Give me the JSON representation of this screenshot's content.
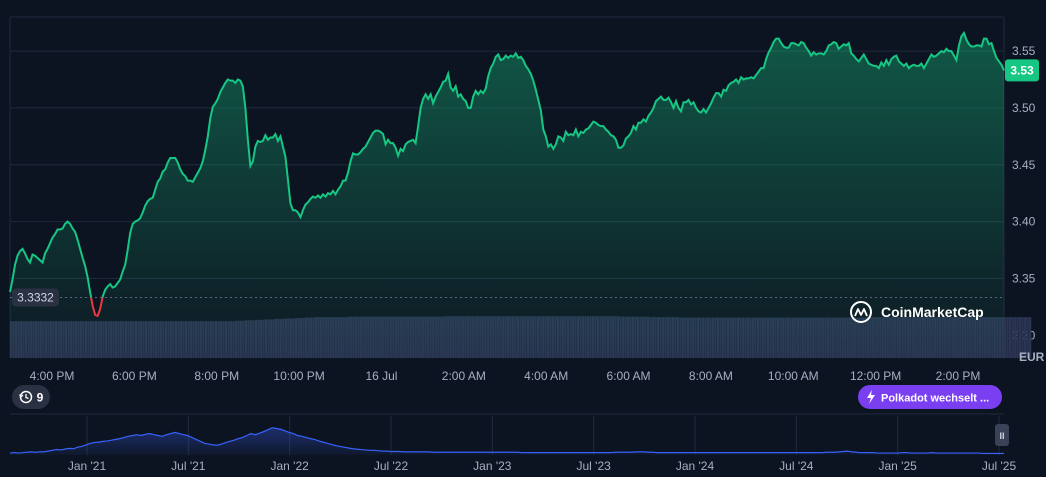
{
  "chart_data": {
    "type": "area",
    "currency_label": "EUR",
    "current_price_label": "3.53",
    "reference_price_label": "3.3332",
    "reference_price": 3.3332,
    "ylim": [
      3.28,
      3.58
    ],
    "y_ticks": [
      3.3,
      3.35,
      3.4,
      3.45,
      3.5,
      3.55
    ],
    "x_ticks": [
      "4:00 PM",
      "6:00 PM",
      "8:00 PM",
      "10:00 PM",
      "16 Jul",
      "2:00 AM",
      "4:00 AM",
      "6:00 AM",
      "8:00 AM",
      "10:00 AM",
      "12:00 PM",
      "2:00 PM"
    ],
    "x": [
      0,
      1,
      2,
      3,
      4,
      5,
      6,
      7,
      8,
      9,
      10,
      11,
      12,
      13,
      14,
      15,
      16,
      17,
      18,
      19,
      20,
      21,
      22,
      23,
      24,
      25,
      26,
      27,
      28,
      29,
      30,
      31,
      32,
      33,
      34,
      35,
      36,
      37,
      38,
      39,
      40,
      41,
      42,
      43,
      44,
      45,
      46,
      47,
      48,
      49,
      50,
      51,
      52,
      53,
      54,
      55,
      56,
      57,
      58,
      59,
      60,
      61,
      62,
      63,
      64,
      65,
      66,
      67,
      68,
      69,
      70,
      71,
      72,
      73,
      74,
      75,
      76,
      77,
      78,
      79,
      80,
      81,
      82,
      83,
      84,
      85,
      86,
      87,
      88,
      89,
      90,
      91,
      92,
      93,
      94,
      95,
      96,
      97,
      98,
      99,
      100,
      101,
      102,
      103,
      104,
      105,
      106,
      107,
      108,
      109,
      110,
      111,
      112,
      113,
      114,
      115,
      116,
      117,
      118,
      119,
      120,
      121,
      122,
      123,
      124,
      125,
      126,
      127,
      128,
      129,
      130,
      131,
      132,
      133,
      134,
      135,
      136,
      137,
      138,
      139,
      140,
      141,
      142,
      143,
      144,
      145,
      146,
      147,
      148,
      149,
      150,
      151,
      152,
      153,
      154,
      155,
      156,
      157,
      158,
      159,
      160,
      161,
      162,
      163,
      164,
      165,
      166,
      167,
      168,
      169,
      170,
      171,
      172,
      173,
      174,
      175,
      176,
      177,
      178,
      179,
      180,
      181,
      182,
      183,
      184,
      185,
      186,
      187,
      188,
      189,
      190,
      191,
      192,
      193,
      194,
      195,
      196,
      197,
      198,
      199,
      200,
      201,
      202,
      203,
      204,
      205,
      206,
      207,
      208,
      209,
      210,
      211,
      212,
      213,
      214,
      215,
      216,
      217,
      218,
      219,
      220,
      221,
      222,
      223,
      224,
      225,
      226,
      227,
      228,
      229,
      230,
      231,
      232,
      233,
      234,
      235,
      236,
      237,
      238,
      239,
      240,
      241,
      242,
      243,
      244,
      245,
      246,
      247,
      248,
      249,
      250,
      251,
      252,
      253,
      254,
      255,
      256,
      257,
      258,
      259,
      260,
      261,
      262,
      263,
      264,
      265,
      266,
      267,
      268,
      269,
      270,
      271,
      272,
      273,
      274,
      275,
      276,
      277,
      278,
      279,
      280,
      281,
      282,
      283,
      284,
      285,
      286,
      287,
      288,
      289,
      290,
      291,
      292,
      293,
      294,
      295,
      296,
      297,
      298,
      299,
      300,
      301,
      302,
      303,
      304,
      305,
      306,
      307,
      308,
      309,
      310,
      311,
      312,
      313,
      314,
      315,
      316,
      317,
      318,
      319,
      320,
      321,
      322,
      323,
      324,
      325,
      326,
      327,
      328,
      329,
      330,
      331,
      332,
      333,
      334,
      335,
      336,
      337,
      338,
      339,
      340,
      341,
      342,
      343,
      344,
      345,
      346,
      347,
      348,
      349,
      350,
      351,
      352,
      353,
      354,
      355,
      356,
      357,
      358,
      359,
      360,
      361,
      362,
      363,
      364,
      365,
      366,
      367,
      368,
      369,
      370,
      371,
      372,
      373,
      374,
      375,
      376,
      377,
      378,
      379,
      380,
      381,
      382,
      383,
      384,
      385,
      386,
      387,
      388,
      389,
      390,
      391,
      392,
      393,
      394,
      395,
      396,
      397,
      398,
      399
    ],
    "values": [
      3.338,
      3.349,
      3.362,
      3.37,
      3.374,
      3.376,
      3.372,
      3.367,
      3.364,
      3.371,
      3.37,
      3.368,
      3.366,
      3.364,
      3.372,
      3.376,
      3.381,
      3.386,
      3.389,
      3.393,
      3.393,
      3.394,
      3.398,
      3.4,
      3.398,
      3.394,
      3.391,
      3.384,
      3.376,
      3.368,
      3.361,
      3.351,
      3.338,
      3.326,
      3.318,
      3.317,
      3.323,
      3.334,
      3.34,
      3.343,
      3.345,
      3.342,
      3.343,
      3.346,
      3.349,
      3.356,
      3.362,
      3.375,
      3.39,
      3.398,
      3.4,
      3.401,
      3.403,
      3.408,
      3.414,
      3.418,
      3.42,
      3.421,
      3.428,
      3.435,
      3.438,
      3.444,
      3.446,
      3.452,
      3.456,
      3.456,
      3.456,
      3.452,
      3.446,
      3.442,
      3.44,
      3.436,
      3.436,
      3.435,
      3.439,
      3.443,
      3.447,
      3.453,
      3.463,
      3.475,
      3.491,
      3.501,
      3.504,
      3.508,
      3.514,
      3.518,
      3.522,
      3.525,
      3.524,
      3.524,
      3.522,
      3.525,
      3.524,
      3.519,
      3.5,
      3.472,
      3.449,
      3.453,
      3.466,
      3.471,
      3.47,
      3.471,
      3.476,
      3.472,
      3.474,
      3.474,
      3.477,
      3.471,
      3.475,
      3.466,
      3.457,
      3.437,
      3.416,
      3.41,
      3.41,
      3.408,
      3.404,
      3.41,
      3.415,
      3.417,
      3.42,
      3.422,
      3.421,
      3.423,
      3.421,
      3.424,
      3.422,
      3.425,
      3.424,
      3.427,
      3.424,
      3.428,
      3.431,
      3.436,
      3.436,
      3.443,
      3.453,
      3.46,
      3.459,
      3.459,
      3.461,
      3.464,
      3.466,
      3.47,
      3.474,
      3.478,
      3.48,
      3.48,
      3.479,
      3.477,
      3.468,
      3.472,
      3.469,
      3.469,
      3.465,
      3.458,
      3.464,
      3.462,
      3.468,
      3.47,
      3.471,
      3.472,
      3.469,
      3.484,
      3.5,
      3.508,
      3.512,
      3.508,
      3.512,
      3.504,
      3.51,
      3.514,
      3.518,
      3.523,
      3.524,
      3.53,
      3.518,
      3.515,
      3.519,
      3.51,
      3.512,
      3.508,
      3.506,
      3.5,
      3.5,
      3.51,
      3.515,
      3.512,
      3.515,
      3.513,
      3.517,
      3.528,
      3.535,
      3.539,
      3.545,
      3.547,
      3.542,
      3.543,
      3.546,
      3.544,
      3.546,
      3.545,
      3.548,
      3.544,
      3.545,
      3.542,
      3.537,
      3.534,
      3.53,
      3.524,
      3.516,
      3.507,
      3.498,
      3.481,
      3.475,
      3.466,
      3.468,
      3.464,
      3.468,
      3.475,
      3.474,
      3.471,
      3.479,
      3.476,
      3.477,
      3.476,
      3.481,
      3.475,
      3.479,
      3.478,
      3.481,
      3.482,
      3.485,
      3.488,
      3.487,
      3.485,
      3.484,
      3.484,
      3.481,
      3.479,
      3.476,
      3.475,
      3.472,
      3.465,
      3.465,
      3.467,
      3.473,
      3.475,
      3.478,
      3.484,
      3.481,
      3.487,
      3.487,
      3.49,
      3.488,
      3.493,
      3.496,
      3.5,
      3.506,
      3.508,
      3.51,
      3.507,
      3.507,
      3.509,
      3.505,
      3.5,
      3.506,
      3.5,
      3.497,
      3.505,
      3.505,
      3.507,
      3.503,
      3.505,
      3.5,
      3.497,
      3.496,
      3.499,
      3.496,
      3.5,
      3.504,
      3.509,
      3.513,
      3.513,
      3.51,
      3.516,
      3.515,
      3.52,
      3.522,
      3.523,
      3.525,
      3.522,
      3.527,
      3.525,
      3.526,
      3.526,
      3.527,
      3.526,
      3.529,
      3.532,
      3.535,
      3.535,
      3.543,
      3.549,
      3.553,
      3.558,
      3.561,
      3.561,
      3.557,
      3.554,
      3.553,
      3.553,
      3.557,
      3.557,
      3.556,
      3.555,
      3.558,
      3.557,
      3.553,
      3.55,
      3.546,
      3.549,
      3.547,
      3.548,
      3.548,
      3.547,
      3.55,
      3.555,
      3.556,
      3.558,
      3.557,
      3.552,
      3.554,
      3.556,
      3.555,
      3.557,
      3.548,
      3.546,
      3.543,
      3.541,
      3.544,
      3.547,
      3.543,
      3.539,
      3.538,
      3.537,
      3.537,
      3.535,
      3.54,
      3.537,
      3.542,
      3.538,
      3.543,
      3.545,
      3.546,
      3.541,
      3.539,
      3.537,
      3.539,
      3.535,
      3.537,
      3.538,
      3.537,
      3.537,
      3.539,
      3.535,
      3.539,
      3.543,
      3.547,
      3.545,
      3.546,
      3.548,
      3.55,
      3.549,
      3.552,
      3.55,
      3.55,
      3.546,
      3.542,
      3.555,
      3.563,
      3.566,
      3.56,
      3.556,
      3.554,
      3.554,
      3.555,
      3.555,
      3.554,
      3.561,
      3.561,
      3.556,
      3.557,
      3.55,
      3.544,
      3.541,
      3.538,
      3.533
    ],
    "volume": [
      0.8,
      0.8,
      0.8,
      0.8,
      0.8,
      0.8,
      0.8,
      0.8,
      0.8,
      0.8,
      0.8,
      0.8,
      0.8,
      0.8,
      0.8,
      0.8,
      0.8,
      0.8,
      0.8,
      0.8,
      0.8,
      0.8,
      0.8,
      0.8,
      0.8,
      0.8,
      0.8,
      0.8,
      0.8,
      0.8,
      0.8,
      0.8,
      0.8,
      0.8,
      0.8,
      0.8,
      0.8,
      0.8,
      0.8,
      0.8,
      0.8,
      0.8,
      0.8,
      0.8,
      0.8,
      0.8,
      0.8,
      0.8,
      0.8,
      0.8,
      0.8,
      0.8,
      0.8,
      0.8,
      0.8,
      0.8,
      0.8,
      0.8,
      0.8,
      0.8,
      0.8,
      0.8,
      0.8,
      0.8,
      0.8,
      0.8,
      0.8,
      0.8,
      0.8,
      0.8,
      0.8,
      0.8,
      0.8,
      0.8,
      0.8,
      0.8,
      0.8,
      0.8,
      0.8,
      0.8,
      0.8,
      0.8,
      0.8,
      0.8,
      0.8,
      0.8,
      0.8,
      0.8,
      0.8,
      0.8,
      0.81,
      0.81,
      0.81,
      0.81,
      0.82,
      0.82,
      0.82,
      0.82,
      0.83,
      0.83,
      0.83,
      0.83,
      0.84,
      0.84,
      0.84,
      0.84,
      0.85,
      0.85,
      0.85,
      0.85,
      0.86,
      0.86,
      0.86,
      0.86,
      0.87,
      0.87,
      0.87,
      0.87,
      0.88,
      0.88,
      0.88,
      0.88,
      0.89,
      0.89,
      0.89,
      0.89,
      0.89,
      0.89,
      0.89,
      0.89,
      0.89,
      0.89,
      0.89,
      0.89,
      0.89,
      0.9,
      0.9,
      0.9,
      0.9,
      0.9,
      0.9,
      0.9,
      0.9,
      0.9,
      0.9,
      0.9,
      0.9,
      0.9,
      0.9,
      0.9,
      0.9,
      0.9,
      0.9,
      0.9,
      0.9,
      0.9,
      0.9,
      0.9,
      0.9,
      0.9,
      0.9,
      0.9,
      0.9,
      0.9,
      0.9,
      0.9,
      0.9,
      0.9,
      0.9,
      0.9,
      0.9,
      0.9,
      0.9,
      0.9,
      0.91,
      0.91,
      0.91,
      0.91,
      0.91,
      0.91,
      0.91,
      0.91,
      0.91,
      0.91,
      0.91,
      0.91,
      0.91,
      0.91,
      0.91,
      0.91,
      0.91,
      0.91,
      0.91,
      0.91,
      0.91,
      0.91,
      0.91,
      0.91,
      0.91,
      0.91,
      0.91,
      0.91,
      0.91,
      0.91,
      0.91,
      0.91,
      0.91,
      0.91,
      0.91,
      0.91,
      0.91,
      0.91,
      0.91,
      0.91,
      0.91,
      0.91,
      0.91,
      0.91,
      0.91,
      0.91,
      0.91,
      0.91,
      0.91,
      0.91,
      0.91,
      0.91,
      0.91,
      0.91,
      0.91,
      0.91,
      0.91,
      0.91,
      0.91,
      0.91,
      0.91,
      0.91,
      0.91,
      0.91,
      0.91,
      0.91,
      0.91,
      0.91,
      0.91,
      0.91,
      0.9,
      0.9,
      0.9,
      0.9,
      0.9,
      0.9,
      0.9,
      0.9,
      0.9,
      0.9,
      0.9,
      0.9,
      0.89,
      0.89,
      0.89,
      0.89,
      0.89,
      0.89,
      0.89,
      0.89,
      0.89,
      0.89,
      0.89,
      0.89,
      0.88,
      0.88,
      0.88,
      0.88,
      0.88,
      0.88,
      0.88,
      0.88,
      0.88,
      0.88,
      0.88,
      0.88,
      0.88,
      0.88,
      0.88,
      0.88,
      0.88,
      0.88,
      0.88,
      0.88,
      0.88,
      0.88,
      0.88,
      0.88,
      0.88,
      0.88,
      0.88,
      0.88,
      0.88,
      0.88,
      0.88,
      0.88,
      0.88,
      0.88,
      0.88,
      0.88,
      0.88,
      0.88,
      0.88,
      0.88,
      0.88,
      0.88,
      0.88,
      0.88,
      0.88,
      0.88,
      0.88,
      0.88,
      0.88,
      0.88,
      0.88,
      0.88,
      0.88,
      0.88,
      0.88,
      0.88,
      0.88,
      0.88,
      0.88,
      0.88,
      0.88,
      0.88,
      0.88,
      0.88,
      0.88,
      0.88,
      0.88,
      0.88,
      0.88,
      0.88,
      0.88,
      0.88,
      0.88,
      0.88,
      0.88,
      0.89,
      0.89,
      0.89,
      0.89,
      0.89,
      0.89,
      0.89,
      0.89,
      0.89,
      0.89,
      0.89,
      0.89,
      0.89,
      0.89,
      0.89,
      0.89,
      0.89,
      0.89,
      0.89,
      0.89,
      0.89,
      0.89,
      0.89,
      0.89,
      0.89,
      0.89,
      0.89,
      0.89,
      0.89,
      0.89,
      0.89,
      0.89,
      0.89,
      0.89,
      0.89,
      0.89,
      0.89,
      0.89,
      0.89,
      0.89,
      0.89,
      0.89,
      0.89,
      0.89,
      0.89,
      0.89,
      0.89,
      0.89,
      0.89,
      0.89,
      0.89,
      0.89,
      0.89,
      0.89,
      0.89,
      0.89,
      0.89,
      0.89,
      0.89,
      0.89,
      0.89,
      0.89,
      0.89,
      0.89,
      0.89,
      0.89
    ],
    "series": [
      {
        "values": []
      }
    ]
  },
  "overview": {
    "x_ticks": [
      "Jan '21",
      "Jul '21",
      "Jan '22",
      "Jul '22",
      "Jan '23",
      "Jul '23",
      "Jan '24",
      "Jul '24",
      "Jan '25",
      "Jul '25"
    ],
    "values": [
      0.05,
      0.06,
      0.05,
      0.06,
      0.07,
      0.08,
      0.07,
      0.08,
      0.08,
      0.1,
      0.12,
      0.14,
      0.13,
      0.15,
      0.17,
      0.16,
      0.2,
      0.22,
      0.26,
      0.3,
      0.32,
      0.33,
      0.35,
      0.36,
      0.38,
      0.4,
      0.42,
      0.45,
      0.48,
      0.5,
      0.52,
      0.5,
      0.53,
      0.55,
      0.52,
      0.5,
      0.48,
      0.52,
      0.55,
      0.58,
      0.55,
      0.52,
      0.5,
      0.45,
      0.4,
      0.35,
      0.3,
      0.28,
      0.26,
      0.25,
      0.28,
      0.32,
      0.35,
      0.38,
      0.42,
      0.45,
      0.5,
      0.55,
      0.52,
      0.56,
      0.6,
      0.65,
      0.7,
      0.68,
      0.66,
      0.62,
      0.58,
      0.55,
      0.5,
      0.48,
      0.45,
      0.42,
      0.4,
      0.36,
      0.33,
      0.3,
      0.27,
      0.24,
      0.22,
      0.2,
      0.18,
      0.16,
      0.15,
      0.14,
      0.13,
      0.12,
      0.12,
      0.11,
      0.1,
      0.1,
      0.09,
      0.09,
      0.09,
      0.08,
      0.08,
      0.08,
      0.08,
      0.08,
      0.08,
      0.08,
      0.07,
      0.07,
      0.07,
      0.07,
      0.07,
      0.07,
      0.07,
      0.07,
      0.07,
      0.07,
      0.07,
      0.07,
      0.07,
      0.07,
      0.07,
      0.07,
      0.07,
      0.07,
      0.07,
      0.07,
      0.07,
      0.06,
      0.06,
      0.06,
      0.06,
      0.06,
      0.06,
      0.06,
      0.06,
      0.06,
      0.06,
      0.06,
      0.06,
      0.06,
      0.06,
      0.06,
      0.06,
      0.06,
      0.06,
      0.06,
      0.06,
      0.06,
      0.06,
      0.07,
      0.07,
      0.07,
      0.07,
      0.07,
      0.08,
      0.08,
      0.08,
      0.07,
      0.07,
      0.06,
      0.06,
      0.06,
      0.06,
      0.06,
      0.06,
      0.06,
      0.06,
      0.06,
      0.06,
      0.06,
      0.06,
      0.06,
      0.06,
      0.06,
      0.06,
      0.06,
      0.06,
      0.06,
      0.06,
      0.06,
      0.06,
      0.06,
      0.06,
      0.06,
      0.06,
      0.06,
      0.06,
      0.06,
      0.06,
      0.06,
      0.06,
      0.06,
      0.06,
      0.06,
      0.06,
      0.06,
      0.06,
      0.06,
      0.06,
      0.07,
      0.07,
      0.07,
      0.08,
      0.09,
      0.1,
      0.08,
      0.07,
      0.06,
      0.06,
      0.06,
      0.06,
      0.05,
      0.05,
      0.05,
      0.05,
      0.05,
      0.05,
      0.06,
      0.06,
      0.05,
      0.05,
      0.05,
      0.05,
      0.05,
      0.06,
      0.05,
      0.05,
      0.05,
      0.05,
      0.05,
      0.05,
      0.05,
      0.05,
      0.05,
      0.05,
      0.05,
      0.04,
      0.04,
      0.04,
      0.04,
      0.04,
      0.04
    ]
  },
  "ui": {
    "logo_text": "CoinMarketCap",
    "event_count": "9",
    "news_pill": "Polkadot wechselt ...",
    "handle_glyph": "II"
  },
  "colors": {
    "background": "#0d1421",
    "line_up": "#16c784",
    "line_down": "#ea3943",
    "badge": "#16c784",
    "volume": "#2b3553",
    "overview_line": "#3861fb",
    "pill": "#7b3ff2"
  }
}
